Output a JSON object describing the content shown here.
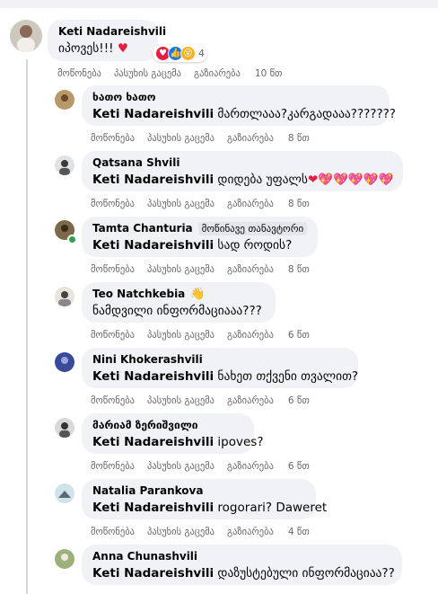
{
  "actions": {
    "like": "მოწონება",
    "reply": "პასუხის გაცემა",
    "share": "გაზიარება"
  },
  "main": {
    "name": "Keti Nadareishvili",
    "text": "იპოვეს!!!",
    "emoji": "♥",
    "reactions_count": "4",
    "time": "10 წთ"
  },
  "replies": [
    {
      "name": "ხათო ხათო",
      "mention": "Keti Nadareishvili",
      "text": "მართლააა?კარგადააა???????",
      "time": "8 წთ"
    },
    {
      "name": "Qatsana Shvili",
      "mention": "Keti Nadareishvili",
      "text": "დიდება უფალს",
      "emoji": "❤💖💖💖💖💖",
      "time": "8 წთ"
    },
    {
      "name": "Tamta Chanturia",
      "badge": "მოწინავე თანავტორი",
      "mention": "Keti Nadareishvili",
      "text": "სად როდის?",
      "time": "8 წთ"
    },
    {
      "name": "Teo Natchkebia",
      "mention": "",
      "text": "ნამდვილი ინფორმაციააა???",
      "time": "6 წთ"
    },
    {
      "name": "Nini Khokerashvili",
      "mention": "Keti Nadareishvili",
      "text": "ნახეთ თქვენი თვალით?",
      "time": "6 წთ"
    },
    {
      "name": "მარიამ ზერიშვილი",
      "mention": "Keti Nadareishvili",
      "text": "ipoves?",
      "time": "6 წთ"
    },
    {
      "name": "Natalia Parankova",
      "mention": "Keti Nadareishvili",
      "text": "rogorari? Daweret",
      "time": "4 წთ"
    },
    {
      "name": "Anna Chunashvili",
      "mention": "Keti Nadareishvili",
      "text": "დაზუსტებული ინფორმაციაა??",
      "time": ""
    }
  ],
  "colors": {
    "bubble": "#f0f2f5",
    "meta": "#65676b",
    "online": "#31a24c",
    "heart": "#e41e3f",
    "like_blue": "#1877f2"
  }
}
